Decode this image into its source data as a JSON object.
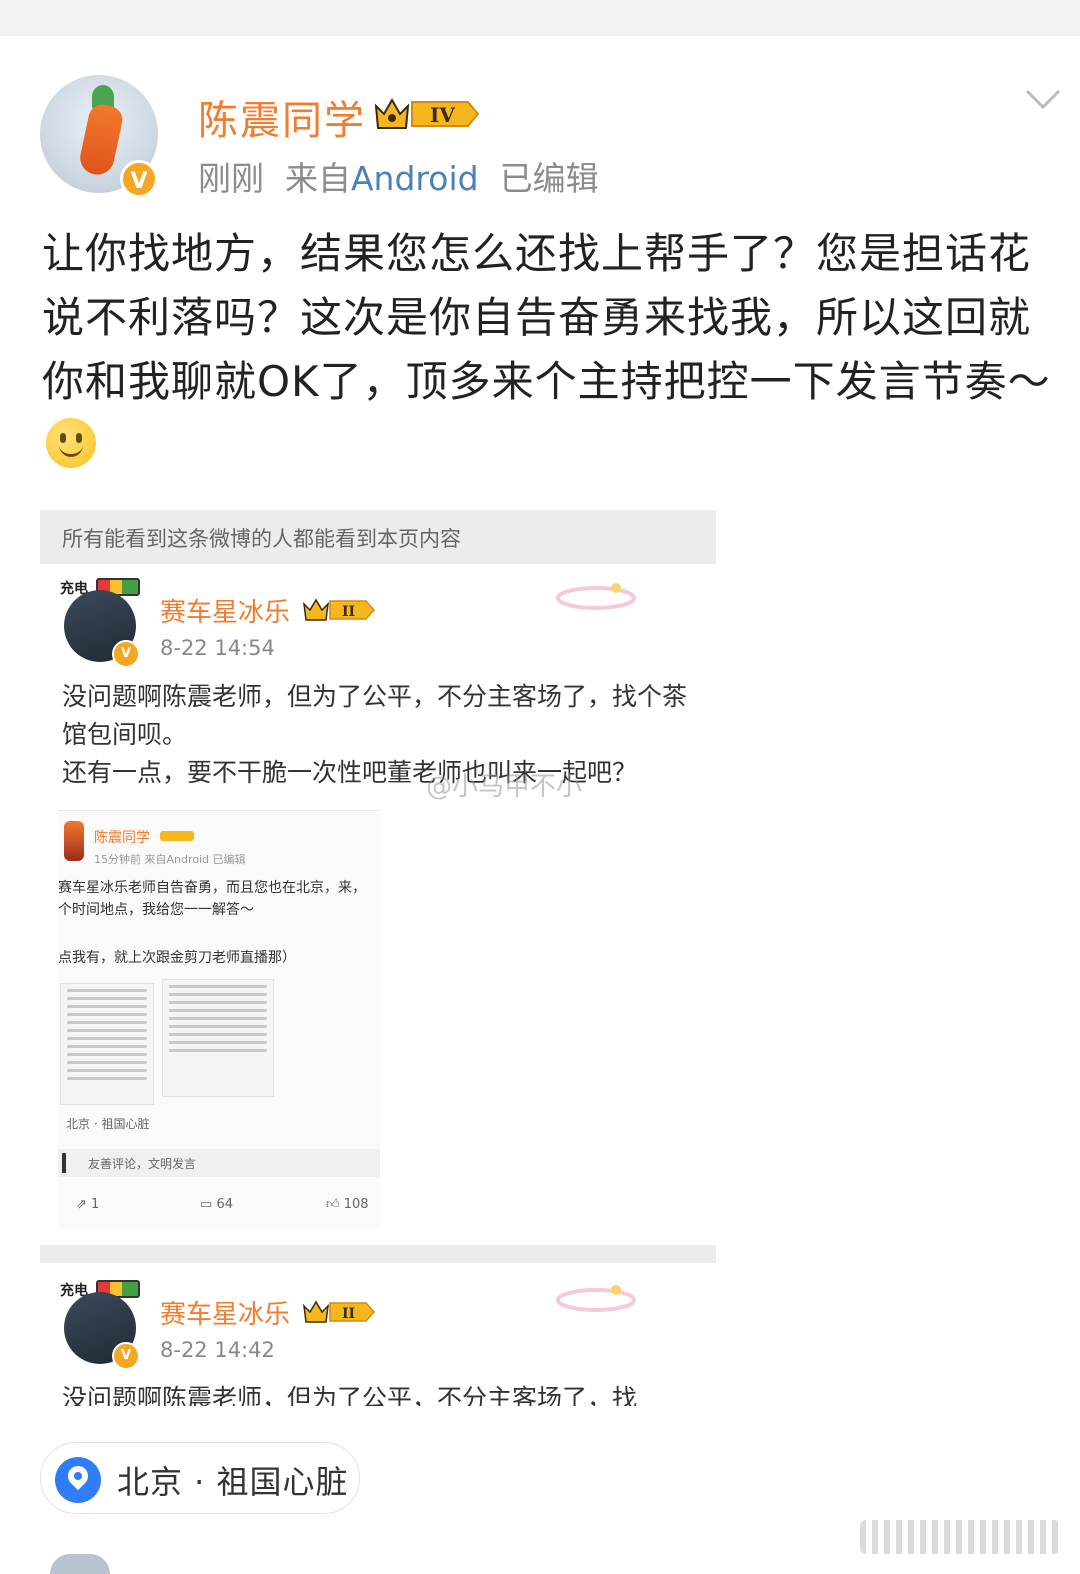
{
  "header": {
    "username": "陈震同学",
    "level": "IV",
    "time": "刚刚",
    "source_prefix": "来自",
    "source": "Android",
    "edited": "已编辑"
  },
  "post": {
    "text": "让你找地方，结果您怎么还找上帮手了？您是担话花说不利落吗？这次是你自告奋勇来找我，所以这回就你和我聊就OK了，顶多来个主持把控一下发言节奏～"
  },
  "screenshot": {
    "banner": "所有能看到这条微博的人都能看到本页内容",
    "comments": [
      {
        "charge_label": "充电",
        "name": "赛车星冰乐",
        "level": "II",
        "time": "8-22 14:54",
        "text": "没问题啊陈震老师，但为了公平，不分主客场了，找个茶馆包间呗。\n还有一点，要不干脆一次性吧董老师也叫来一起吧？"
      },
      {
        "charge_label": "充电",
        "name": "赛车星冰乐",
        "level": "II",
        "time": "8-22 14:42",
        "text": "没问题啊陈震老师，但为了公平，不分主客场了，找"
      }
    ],
    "watermark": "@小马甲不小",
    "inner_post": {
      "name": "陈震同学",
      "meta": "15分钟前  来自Android  已编辑",
      "text": "赛车星冰乐老师自告奋勇，而且您也在北京，来，\n个时间地点，我给您一一解答～",
      "sub": "点我有，就上次跟金剪刀老师直播那）",
      "location": "北京 · 祖国心脏",
      "comment_placeholder": "友善评论，文明发言",
      "reposts": "1",
      "comments": "64",
      "likes": "108"
    }
  },
  "location": {
    "label": "北京 · 祖国心脏"
  },
  "colors": {
    "username": "#f07c2f",
    "source_link": "#4d7fb8",
    "location_icon": "#2f7df6",
    "vip_badge": "#f5a623"
  }
}
